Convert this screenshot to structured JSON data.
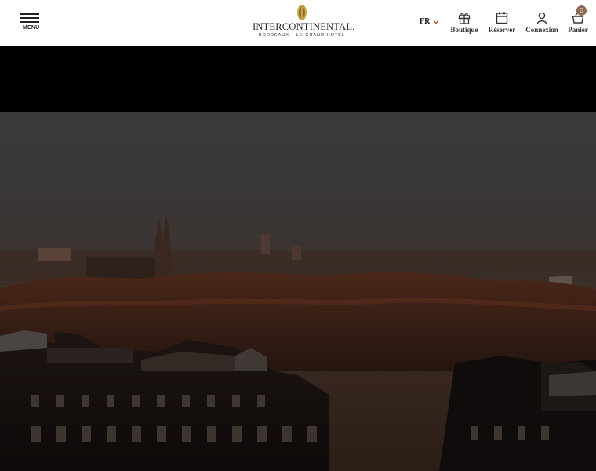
{
  "header": {
    "menu_label": "MENU",
    "logo": {
      "name": "INTERCONTINENTAL.",
      "subtitle": "BORDEAUX – LE GRAND HOTEL"
    },
    "language": "FR",
    "nav": [
      {
        "label": "Boutique",
        "icon": "gift-icon"
      },
      {
        "label": "Réserver",
        "icon": "calendar-icon"
      },
      {
        "label": "Connexion",
        "icon": "user-icon"
      },
      {
        "label": "Panier",
        "icon": "basket-icon"
      }
    ],
    "cart_count": "0"
  },
  "hero": {
    "image": "Bordeaux city skyline at dusk with cathedral spires"
  },
  "colors": {
    "header_bg": "#ffffff",
    "text": "#222222",
    "badge": "#8a6b56",
    "logo_gold": "#b8892e"
  }
}
